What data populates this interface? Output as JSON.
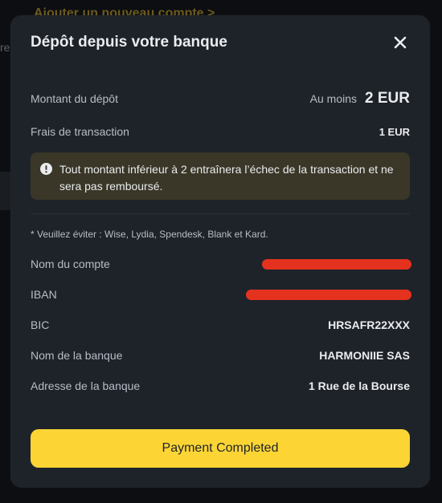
{
  "background": {
    "link_text": "Ajouter un nouveau compte >",
    "side_text": "re"
  },
  "modal": {
    "title": "Dépôt depuis votre banque",
    "close_icon": "close-icon"
  },
  "deposit": {
    "amount_label": "Montant du dépôt",
    "amount_prefix": "Au moins",
    "amount_value": "2 EUR",
    "fee_label": "Frais de transaction",
    "fee_value": "1 EUR"
  },
  "warning": {
    "icon": "exclamation-circle-icon",
    "text": "Tout montant inférieur à 2  entraînera l’échec de la transaction et ne sera pas remboursé."
  },
  "note": "* Veuillez éviter : Wise, Lydia, Spendesk, Blank et Kard.",
  "details": {
    "account_name_label": "Nom du compte",
    "iban_label": "IBAN",
    "bic_label": "BIC",
    "bic_value": "HRSAFR22XXX",
    "bank_name_label": "Nom de la banque",
    "bank_name_value": "HARMONIIE SAS",
    "bank_address_label": "Adresse de la banque",
    "bank_address_value": "1 Rue de la Bourse"
  },
  "button": {
    "label": "Payment Completed"
  },
  "colors": {
    "accent": "#fcd535",
    "panel": "#1e2329",
    "warning_bg": "#3a3728",
    "redaction": "#e4321f"
  }
}
